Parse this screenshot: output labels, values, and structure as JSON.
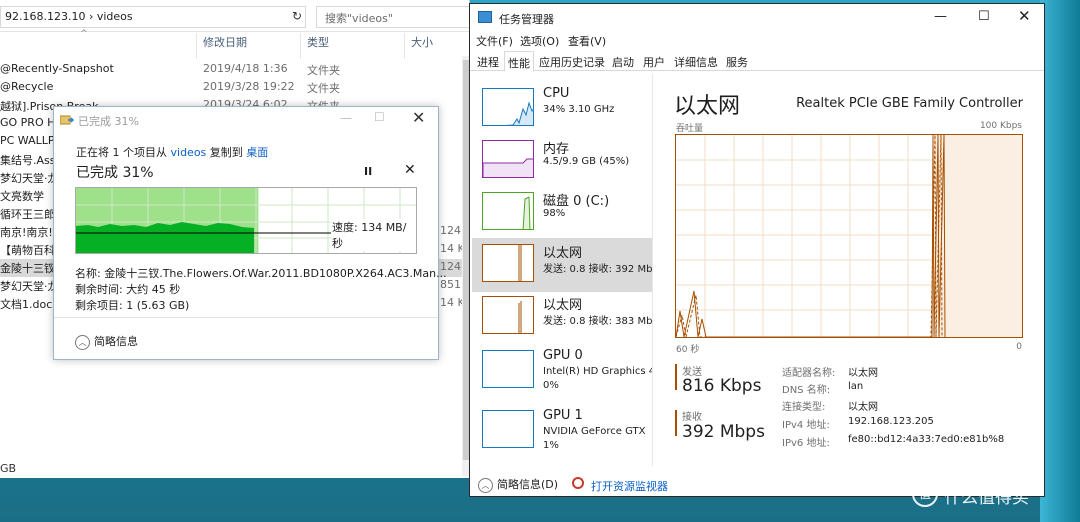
{
  "explorer": {
    "address": "92.168.123.10  ›  videos",
    "search_placeholder": "搜索\"videos\"",
    "columns": {
      "date": "修改日期",
      "type": "类型",
      "size": "大小"
    },
    "files": [
      {
        "name": "@Recently-Snapshot",
        "date": "2019/4/18 1:36",
        "type": "文件夹",
        "size": ""
      },
      {
        "name": "@Recycle",
        "date": "2019/3/28 19:22",
        "type": "文件夹",
        "size": ""
      },
      {
        "name": "越狱].Prison.Break",
        "date": "2019/3/24 6:02",
        "type": "文件夹",
        "size": ""
      },
      {
        "name": "GO PRO HE",
        "date": "",
        "type": "",
        "size": ""
      },
      {
        "name": "PC WALLPA",
        "date": "",
        "type": "",
        "size": ""
      },
      {
        "name": "集结号.Asse",
        "date": "",
        "type": "",
        "size": ""
      },
      {
        "name": "梦幻天堂·龙",
        "date": "",
        "type": "",
        "size": ""
      },
      {
        "name": "文亮数学",
        "date": "",
        "type": "",
        "size": ""
      },
      {
        "name": "循环王三郎",
        "date": "",
        "type": "",
        "size": ""
      },
      {
        "name": "南京!南京!(",
        "date": "",
        "type": "",
        "size": "124..."
      },
      {
        "name": "【萌物百科】",
        "date": "",
        "type": "",
        "size": "14 KB"
      },
      {
        "name": "金陵十三钗.",
        "date": "",
        "type": "",
        "size": "124..."
      },
      {
        "name": "梦幻天堂·龙",
        "date": "",
        "type": "",
        "size": "851..."
      },
      {
        "name": "文档1.docx",
        "date": "",
        "type": "",
        "size": "14 KB"
      }
    ],
    "status": "GB"
  },
  "copy_dialog": {
    "title": "已完成 31%",
    "line_prefix": "正在将 1 个项目从 ",
    "source": "videos",
    "line_mid": " 复制到 ",
    "dest": "桌面",
    "percent_text": "已完成 31%",
    "progress_percent": 31,
    "speed_text": "速度: 134 MB/秒",
    "name_row": "名称: 金陵十三钗.The.Flowers.Of.War.2011.BD1080P.X264.AC3.Man...",
    "time_row": "剩余时间: 大约 45 秒",
    "items_row": "剩余项目: 1 (5.63 GB)",
    "brief_label": "简略信息",
    "pause_glyph": "II",
    "close_glyph": "✕"
  },
  "task_manager": {
    "title": "任务管理器",
    "menu": [
      "文件(F)",
      "选项(O)",
      "查看(V)"
    ],
    "tabs": [
      "进程",
      "性能",
      "应用历史记录",
      "启动",
      "用户",
      "详细信息",
      "服务"
    ],
    "active_tab": "性能",
    "resources": [
      {
        "name": "CPU",
        "sub": "34% 3.10 GHz",
        "sub2": "",
        "color": "#1479c0"
      },
      {
        "name": "内存",
        "sub": "4.5/9.9 GB (45%)",
        "sub2": "",
        "color": "#8b2ca3"
      },
      {
        "name": "磁盘 0 (C:)",
        "sub": "98%",
        "sub2": "",
        "color": "#4ea525"
      },
      {
        "name": "以太网",
        "sub": "发送: 0.8  接收: 392 Mb",
        "sub2": "",
        "color": "#a74f01"
      },
      {
        "name": "以太网",
        "sub": "发送: 0.8  接收: 383 Mb",
        "sub2": "",
        "color": "#a74f01"
      },
      {
        "name": "GPU 0",
        "sub": "Intel(R) HD Graphics 4",
        "sub2": "0%",
        "color": "#1479c0"
      },
      {
        "name": "GPU 1",
        "sub": "NVIDIA GeForce GTX",
        "sub2": "1%",
        "color": "#1479c0"
      }
    ],
    "detail": {
      "title": "以太网",
      "adapter": "Realtek PCIe GBE Family Controller",
      "throughput_label": "吞吐量",
      "max_label": "100 Kbps",
      "axis_left": "60 秒",
      "axis_right": "0",
      "send_label": "发送",
      "send_value": "816 Kbps",
      "recv_label": "接收",
      "recv_value": "392 Mbps",
      "props": [
        {
          "k": "适配器名称:",
          "v": "以太网"
        },
        {
          "k": "DNS 名称:",
          "v": "lan"
        },
        {
          "k": "连接类型:",
          "v": "以太网"
        },
        {
          "k": "IPv4 地址:",
          "v": "192.168.123.205"
        },
        {
          "k": "IPv6 地址:",
          "v": "fe80::bd12:4a33:7ed0:e81b%8"
        }
      ]
    },
    "footer": {
      "brief": "简略信息(D)",
      "resmon": "打开资源监视器"
    }
  },
  "watermark": "值 什么值得买"
}
